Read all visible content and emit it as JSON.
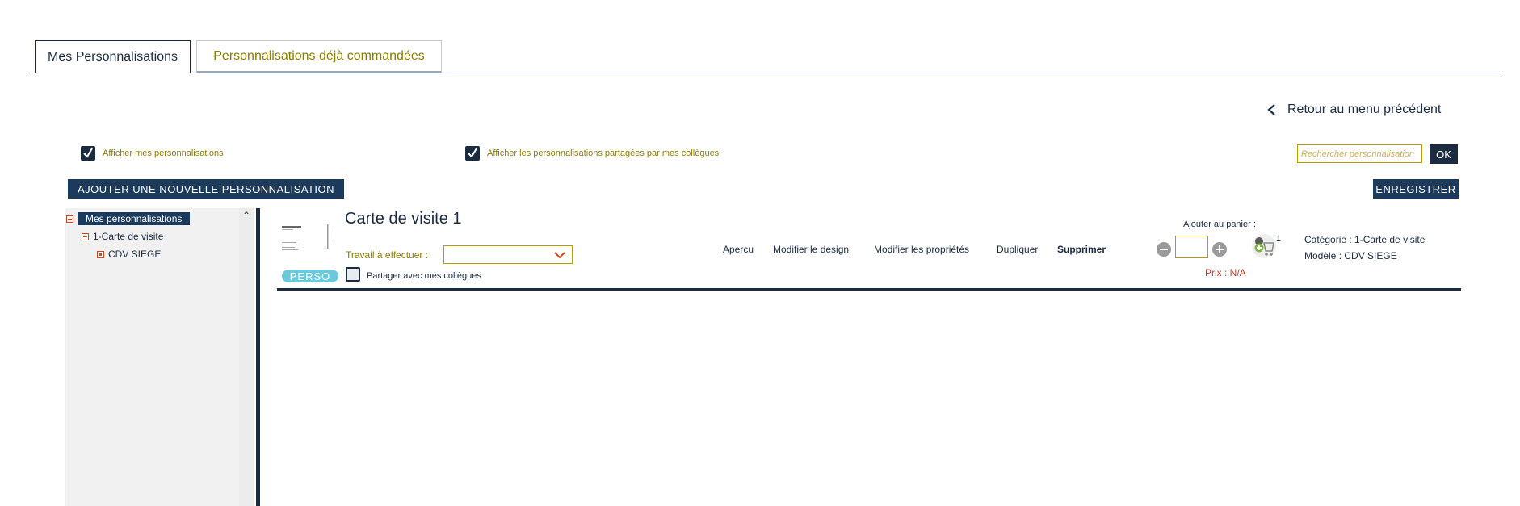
{
  "tabs": {
    "active": "Mes Personnalisations",
    "inactive": "Personnalisations déjà commandées"
  },
  "back_link": "Retour au menu précédent",
  "filters": {
    "show_mine": "Afficher mes personnalisations",
    "show_shared": "Afficher les personnalisations partagées par mes collègues"
  },
  "search": {
    "placeholder": "Rechercher personnalisation",
    "ok_label": "OK"
  },
  "buttons": {
    "add_new": "AJOUTER UNE NOUVELLE PERSONNALISATION",
    "save": "ENREGISTRER"
  },
  "tree": {
    "root": "Mes personnalisations",
    "child": "1-Carte de visite",
    "leaf": "CDV SIEGE"
  },
  "item": {
    "title": "Carte de visite 1",
    "badge": "PERSO",
    "travail_label": "Travail à effectuer :",
    "travail_value": "",
    "share_label": "Partager avec mes collègues",
    "actions": {
      "apercu": "Apercu",
      "modifier_design": "Modifier le design",
      "modifier_proprietes": "Modifier les propriétés",
      "dupliquer": "Dupliquer",
      "supprimer": "Supprimer"
    },
    "cart": {
      "label": "Ajouter au panier :",
      "quantity": "",
      "count": "1",
      "price": "Prix : N/A"
    },
    "category": "Catégorie : 1-Carte de visite",
    "model": "Modèle : CDV SIEGE"
  },
  "colors": {
    "navy": "#1b2b40",
    "gold": "#8b7d00",
    "badge": "#6ec8dc",
    "price_red": "#c0392b"
  }
}
